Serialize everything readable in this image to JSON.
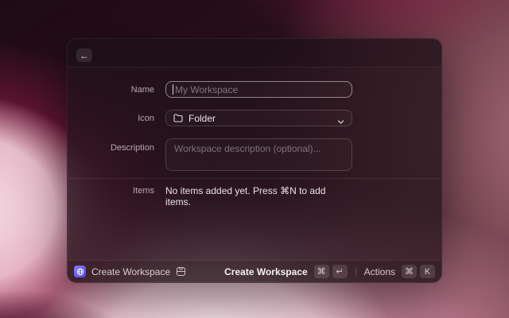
{
  "window": {
    "back_button": {
      "glyph": "←"
    },
    "form": {
      "name_label": "Name",
      "name_placeholder": "My Workspace",
      "icon_label": "Icon",
      "icon_value": "Folder",
      "description_label": "Description",
      "description_placeholder": "Workspace description (optional)...",
      "items_label": "Items",
      "items_empty_text": "No items added yet. Press ⌘N to add items."
    },
    "footer": {
      "command_title": "Create Workspace",
      "submit_label": "Create Workspace",
      "submit_keys": [
        "⌘",
        "↵"
      ],
      "actions_label": "Actions",
      "actions_keys": [
        "⌘",
        "K"
      ]
    }
  },
  "colors": {
    "accent_icon_gradient_start": "#8b7cf8",
    "accent_icon_gradient_end": "#4f46e5",
    "modal_background": "#20131a",
    "focused_field_border": "rgba(255,255,255,0.48)"
  }
}
